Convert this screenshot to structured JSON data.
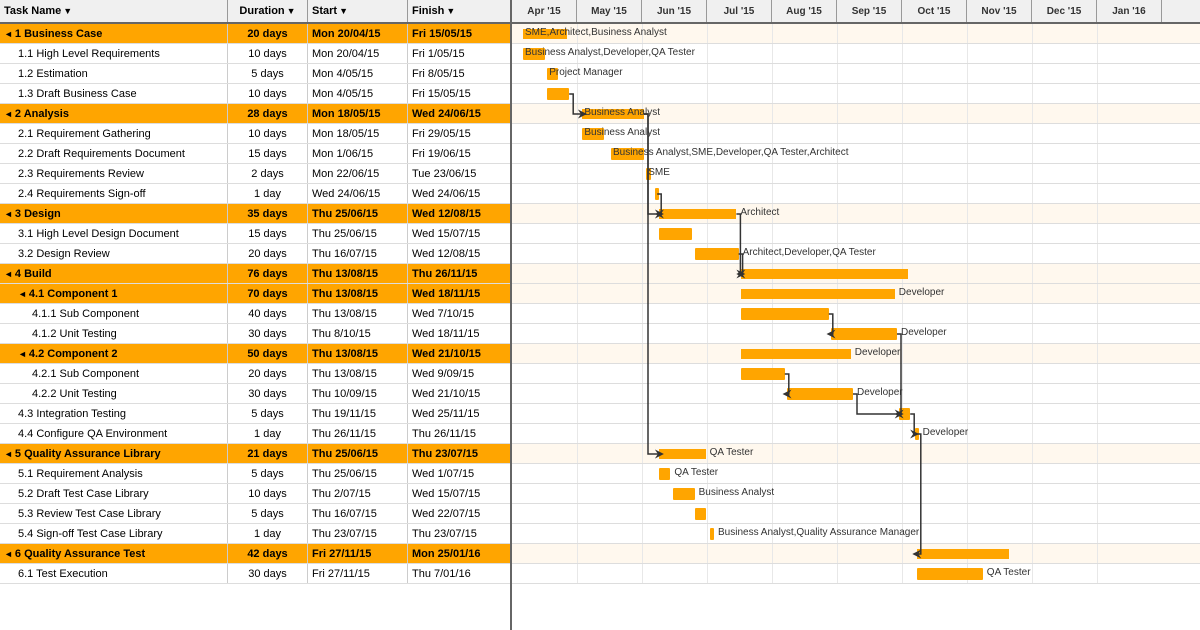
{
  "header": {
    "columns": [
      {
        "label": "Task Name",
        "sort": true
      },
      {
        "label": "Duration",
        "sort": true
      },
      {
        "label": "Start",
        "sort": true
      },
      {
        "label": "Finish",
        "sort": true
      }
    ]
  },
  "months": [
    {
      "label": "Apr '15",
      "width": 65
    },
    {
      "label": "May '15",
      "width": 65
    },
    {
      "label": "Jun '15",
      "width": 65
    },
    {
      "label": "Jul '15",
      "width": 65
    },
    {
      "label": "Aug '15",
      "width": 65
    },
    {
      "label": "Sep '15",
      "width": 65
    },
    {
      "label": "Oct '15",
      "width": 65
    },
    {
      "label": "Nov '15",
      "width": 65
    },
    {
      "label": "Dec '15",
      "width": 65
    },
    {
      "label": "Jan '16",
      "width": 65
    }
  ],
  "tasks": [
    {
      "id": "t1",
      "name": "1 Business Case",
      "duration": "20 days",
      "start": "Mon 20/04/15",
      "finish": "Fri 15/05/15",
      "level": 0,
      "summary": true,
      "collapse": true
    },
    {
      "id": "t11",
      "name": "1.1 High Level Requirements",
      "duration": "10 days",
      "start": "Mon 20/04/15",
      "finish": "Fri 1/05/15",
      "level": 1,
      "summary": false
    },
    {
      "id": "t12",
      "name": "1.2 Estimation",
      "duration": "5 days",
      "start": "Mon 4/05/15",
      "finish": "Fri 8/05/15",
      "level": 1,
      "summary": false
    },
    {
      "id": "t13",
      "name": "1.3 Draft Business Case",
      "duration": "10 days",
      "start": "Mon 4/05/15",
      "finish": "Fri 15/05/15",
      "level": 1,
      "summary": false
    },
    {
      "id": "t2",
      "name": "2 Analysis",
      "duration": "28 days",
      "start": "Mon 18/05/15",
      "finish": "Wed 24/06/15",
      "level": 0,
      "summary": true,
      "collapse": true
    },
    {
      "id": "t21",
      "name": "2.1 Requirement Gathering",
      "duration": "10 days",
      "start": "Mon 18/05/15",
      "finish": "Fri 29/05/15",
      "level": 1,
      "summary": false
    },
    {
      "id": "t22",
      "name": "2.2 Draft Requirements Document",
      "duration": "15 days",
      "start": "Mon 1/06/15",
      "finish": "Fri 19/06/15",
      "level": 1,
      "summary": false
    },
    {
      "id": "t23",
      "name": "2.3 Requirements Review",
      "duration": "2 days",
      "start": "Mon 22/06/15",
      "finish": "Tue 23/06/15",
      "level": 1,
      "summary": false
    },
    {
      "id": "t24",
      "name": "2.4 Requirements Sign-off",
      "duration": "1 day",
      "start": "Wed 24/06/15",
      "finish": "Wed 24/06/15",
      "level": 1,
      "summary": false
    },
    {
      "id": "t3",
      "name": "3 Design",
      "duration": "35 days",
      "start": "Thu 25/06/15",
      "finish": "Wed 12/08/15",
      "level": 0,
      "summary": true,
      "collapse": true
    },
    {
      "id": "t31",
      "name": "3.1 High Level Design Document",
      "duration": "15 days",
      "start": "Thu 25/06/15",
      "finish": "Wed 15/07/15",
      "level": 1,
      "summary": false
    },
    {
      "id": "t32",
      "name": "3.2 Design Review",
      "duration": "20 days",
      "start": "Thu 16/07/15",
      "finish": "Wed 12/08/15",
      "level": 1,
      "summary": false
    },
    {
      "id": "t4",
      "name": "4 Build",
      "duration": "76 days",
      "start": "Thu 13/08/15",
      "finish": "Thu 26/11/15",
      "level": 0,
      "summary": true,
      "collapse": true
    },
    {
      "id": "t41",
      "name": "4.1 Component 1",
      "duration": "70 days",
      "start": "Thu 13/08/15",
      "finish": "Wed 18/11/15",
      "level": 1,
      "summary": true,
      "collapse": true
    },
    {
      "id": "t411",
      "name": "4.1.1 Sub Component",
      "duration": "40 days",
      "start": "Thu 13/08/15",
      "finish": "Wed 7/10/15",
      "level": 2,
      "summary": false
    },
    {
      "id": "t412",
      "name": "4.1.2 Unit Testing",
      "duration": "30 days",
      "start": "Thu 8/10/15",
      "finish": "Wed 18/11/15",
      "level": 2,
      "summary": false
    },
    {
      "id": "t42",
      "name": "4.2 Component 2",
      "duration": "50 days",
      "start": "Thu 13/08/15",
      "finish": "Wed 21/10/15",
      "level": 1,
      "summary": true,
      "collapse": true
    },
    {
      "id": "t421",
      "name": "4.2.1 Sub Component",
      "duration": "20 days",
      "start": "Thu 13/08/15",
      "finish": "Wed 9/09/15",
      "level": 2,
      "summary": false
    },
    {
      "id": "t422",
      "name": "4.2.2 Unit Testing",
      "duration": "30 days",
      "start": "Thu 10/09/15",
      "finish": "Wed 21/10/15",
      "level": 2,
      "summary": false
    },
    {
      "id": "t43",
      "name": "4.3 Integration Testing",
      "duration": "5 days",
      "start": "Thu 19/11/15",
      "finish": "Wed 25/11/15",
      "level": 1,
      "summary": false
    },
    {
      "id": "t44",
      "name": "4.4 Configure QA Environment",
      "duration": "1 day",
      "start": "Thu 26/11/15",
      "finish": "Thu 26/11/15",
      "level": 1,
      "summary": false
    },
    {
      "id": "t5",
      "name": "5 Quality Assurance Library",
      "duration": "21 days",
      "start": "Thu 25/06/15",
      "finish": "Thu 23/07/15",
      "level": 0,
      "summary": true,
      "collapse": true
    },
    {
      "id": "t51",
      "name": "5.1 Requirement Analysis",
      "duration": "5 days",
      "start": "Thu 25/06/15",
      "finish": "Wed 1/07/15",
      "level": 1,
      "summary": false
    },
    {
      "id": "t52",
      "name": "5.2 Draft Test Case Library",
      "duration": "10 days",
      "start": "Thu 2/07/15",
      "finish": "Wed 15/07/15",
      "level": 1,
      "summary": false
    },
    {
      "id": "t53",
      "name": "5.3 Review Test Case Library",
      "duration": "5 days",
      "start": "Thu 16/07/15",
      "finish": "Wed 22/07/15",
      "level": 1,
      "summary": false
    },
    {
      "id": "t54",
      "name": "5.4 Sign-off Test Case Library",
      "duration": "1 day",
      "start": "Thu 23/07/15",
      "finish": "Thu 23/07/15",
      "level": 1,
      "summary": false
    },
    {
      "id": "t6",
      "name": "6 Quality Assurance Test",
      "duration": "42 days",
      "start": "Fri 27/11/15",
      "finish": "Mon 25/01/16",
      "level": 0,
      "summary": true,
      "collapse": true
    },
    {
      "id": "t61",
      "name": "6.1 Test Execution",
      "duration": "30 days",
      "start": "Fri 27/11/15",
      "finish": "Thu 7/01/16",
      "level": 1,
      "summary": false
    }
  ],
  "gantt": {
    "startDate": "2015-04-13",
    "pixelsPerDay": 2.2,
    "bars": [
      {
        "taskId": "t1",
        "startDay": 5,
        "widthDay": 20,
        "label": "SME,Architect,Business Analyst",
        "labelRight": false
      },
      {
        "taskId": "t11",
        "startDay": 5,
        "widthDay": 10,
        "label": "Business Analyst,Developer,QA Tester",
        "labelRight": false
      },
      {
        "taskId": "t12",
        "startDay": 16,
        "widthDay": 5,
        "label": "Project Manager",
        "labelRight": false
      },
      {
        "taskId": "t13",
        "startDay": 16,
        "widthDay": 10,
        "label": "",
        "labelRight": false
      },
      {
        "taskId": "t2",
        "startDay": 32,
        "widthDay": 28,
        "label": "Business Analyst",
        "labelRight": false
      },
      {
        "taskId": "t21",
        "startDay": 32,
        "widthDay": 10,
        "label": "Business Analyst",
        "labelRight": false
      },
      {
        "taskId": "t22",
        "startDay": 45,
        "widthDay": 15,
        "label": "Business Analyst,SME,Developer,QA Tester,Architect",
        "labelRight": false
      },
      {
        "taskId": "t23",
        "startDay": 61,
        "widthDay": 2,
        "label": "SME",
        "labelRight": false
      },
      {
        "taskId": "t24",
        "startDay": 65,
        "widthDay": 1,
        "label": "",
        "labelRight": false
      },
      {
        "taskId": "t3",
        "startDay": 67,
        "widthDay": 35,
        "label": "Architect",
        "labelRight": true
      },
      {
        "taskId": "t31",
        "startDay": 67,
        "widthDay": 15,
        "label": "",
        "labelRight": false
      },
      {
        "taskId": "t32",
        "startDay": 83,
        "widthDay": 20,
        "label": "Architect,Developer,QA Tester",
        "labelRight": true
      },
      {
        "taskId": "t4",
        "startDay": 104,
        "widthDay": 76,
        "label": "",
        "labelRight": false
      },
      {
        "taskId": "t41",
        "startDay": 104,
        "widthDay": 70,
        "label": "Developer",
        "labelRight": true
      },
      {
        "taskId": "t411",
        "startDay": 104,
        "widthDay": 40,
        "label": "",
        "labelRight": false
      },
      {
        "taskId": "t412",
        "startDay": 145,
        "widthDay": 30,
        "label": "Developer",
        "labelRight": true
      },
      {
        "taskId": "t42",
        "startDay": 104,
        "widthDay": 50,
        "label": "Developer",
        "labelRight": true
      },
      {
        "taskId": "t421",
        "startDay": 104,
        "widthDay": 20,
        "label": "",
        "labelRight": false
      },
      {
        "taskId": "t422",
        "startDay": 125,
        "widthDay": 30,
        "label": "Developer",
        "labelRight": true
      },
      {
        "taskId": "t43",
        "startDay": 176,
        "widthDay": 5,
        "label": "",
        "labelRight": false
      },
      {
        "taskId": "t44",
        "startDay": 183,
        "widthDay": 1,
        "label": "Developer",
        "labelRight": true
      },
      {
        "taskId": "t5",
        "startDay": 67,
        "widthDay": 21,
        "label": "QA Tester",
        "labelRight": true
      },
      {
        "taskId": "t51",
        "startDay": 67,
        "widthDay": 5,
        "label": "QA Tester",
        "labelRight": true
      },
      {
        "taskId": "t52",
        "startDay": 73,
        "widthDay": 10,
        "label": "Business Analyst",
        "labelRight": true
      },
      {
        "taskId": "t53",
        "startDay": 83,
        "widthDay": 5,
        "label": "",
        "labelRight": false
      },
      {
        "taskId": "t54",
        "startDay": 90,
        "widthDay": 1,
        "label": "Business Analyst,Quality Assurance Manager",
        "labelRight": true
      },
      {
        "taskId": "t6",
        "startDay": 184,
        "widthDay": 42,
        "label": "",
        "labelRight": false
      },
      {
        "taskId": "t61",
        "startDay": 184,
        "widthDay": 30,
        "label": "QA Tester",
        "labelRight": true
      }
    ]
  },
  "colors": {
    "summary_bg": "#FFA500",
    "task_bar": "#FFA500",
    "header_bg": "#f0f0f0",
    "grid_line": "#e0e0e0",
    "border": "#999"
  }
}
